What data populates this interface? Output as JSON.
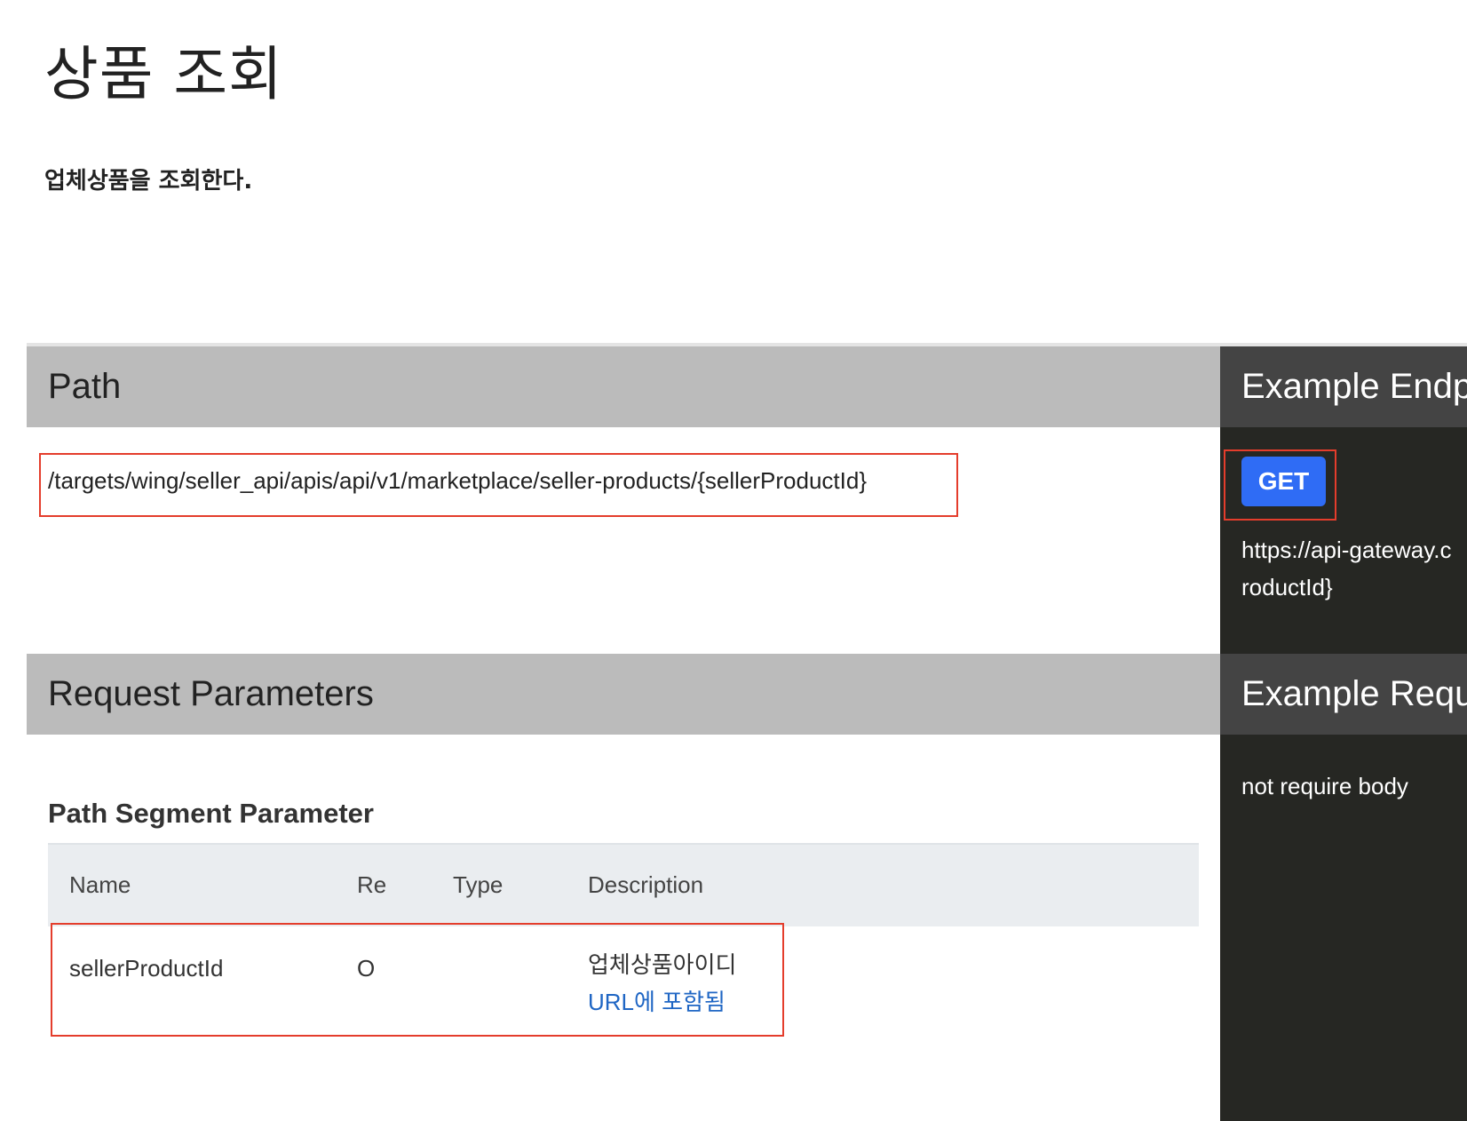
{
  "page": {
    "title": "상품 조회",
    "description": "업체상품을 조회한다."
  },
  "path_section": {
    "header": "Path",
    "path": "/targets/wing/seller_api/apis/api/v1/marketplace/seller-products/{sellerProductId}"
  },
  "endpoint_section": {
    "header": "Example Endp",
    "method": "GET",
    "url_line1": "https://api-gateway.c",
    "url_line2": "roductId}"
  },
  "params_section": {
    "header": "Request Parameters",
    "subsection": "Path Segment Parameter",
    "columns": {
      "name": "Name",
      "required": "Re",
      "type": "Type",
      "description": "Description"
    },
    "rows": [
      {
        "name": "sellerProductId",
        "required": "O",
        "type": "",
        "description": "업체상품아이디",
        "note": "URL에 포함됨"
      }
    ]
  },
  "request_section": {
    "header": "Example Requ",
    "body_text": "not require body"
  },
  "colors": {
    "method_badge": "#2f6cf5",
    "highlight_border": "#e43d2c",
    "link": "#1f66c4",
    "dark_panel": "#262723"
  }
}
